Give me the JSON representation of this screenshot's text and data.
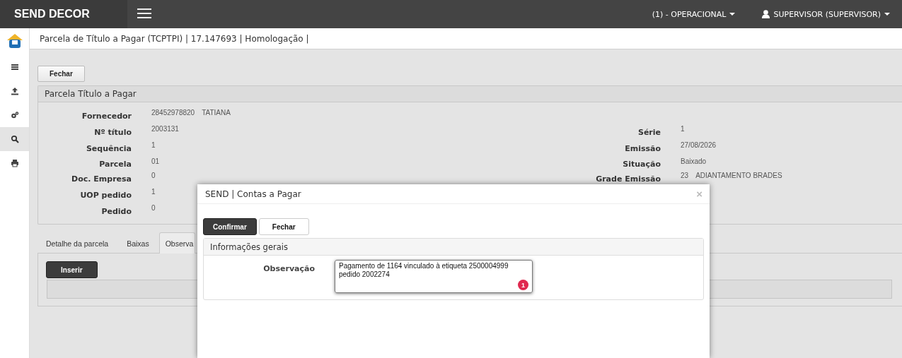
{
  "header": {
    "brand": "SEND DECOR",
    "unit_menu": "(1) - OPERACIONAL",
    "user_menu": "SUPERVISOR (SUPERVISOR)"
  },
  "sidebar": {
    "items": [
      {
        "kind": "list",
        "selected": false
      },
      {
        "kind": "upload",
        "selected": false
      },
      {
        "kind": "gears",
        "selected": false
      },
      {
        "kind": "search",
        "selected": true
      },
      {
        "kind": "print",
        "selected": false
      }
    ]
  },
  "breadcrumb": "Parcela de Título a Pagar (TCPTPI) | 17.147693 | Homologação |",
  "close_button": "Fechar",
  "panel": {
    "title": "Parcela Título a Pagar",
    "left_fields": [
      {
        "label": "Fornecedor",
        "values": [
          "28452978820",
          "TATIANA"
        ]
      },
      {
        "label": "Nº título",
        "values": [
          "2003131"
        ]
      },
      {
        "label": "Sequência",
        "values": [
          "1"
        ]
      },
      {
        "label": "Parcela",
        "values": [
          "01"
        ]
      },
      {
        "label": "Doc. Empresa",
        "values": [
          "0"
        ]
      },
      {
        "label": "UOP pedido",
        "values": [
          "1"
        ]
      },
      {
        "label": "Pedido",
        "values": [
          "0"
        ]
      }
    ],
    "right_fields": [
      {
        "label": "Série",
        "values": [
          "1"
        ]
      },
      {
        "label": "Emissão",
        "values": [
          "27/08/2026"
        ]
      },
      {
        "label": "Situação",
        "values": [
          "Baixado"
        ]
      },
      {
        "label": "Grade Emissão",
        "values": [
          "23",
          "ADIANTAMENTO BRADES"
        ]
      }
    ]
  },
  "tabs": [
    {
      "label": "Detalhe da parcela",
      "selected": false
    },
    {
      "label": "Baixas",
      "selected": false
    },
    {
      "label": "Observa",
      "selected": true
    }
  ],
  "insert_button": "Inserir",
  "dialog": {
    "title": "SEND | Contas a Pagar",
    "close": "×",
    "buttons": [
      {
        "label": "Confirmar",
        "kind": "primary"
      },
      {
        "label": "Fechar",
        "kind": "default"
      }
    ],
    "section": {
      "title": "Informações gerais",
      "field": {
        "label": "Observação",
        "value": "Pagamento de 1164 vinculado à etiqueta 2500004999 pedido 2002274",
        "badge": "1"
      }
    }
  }
}
